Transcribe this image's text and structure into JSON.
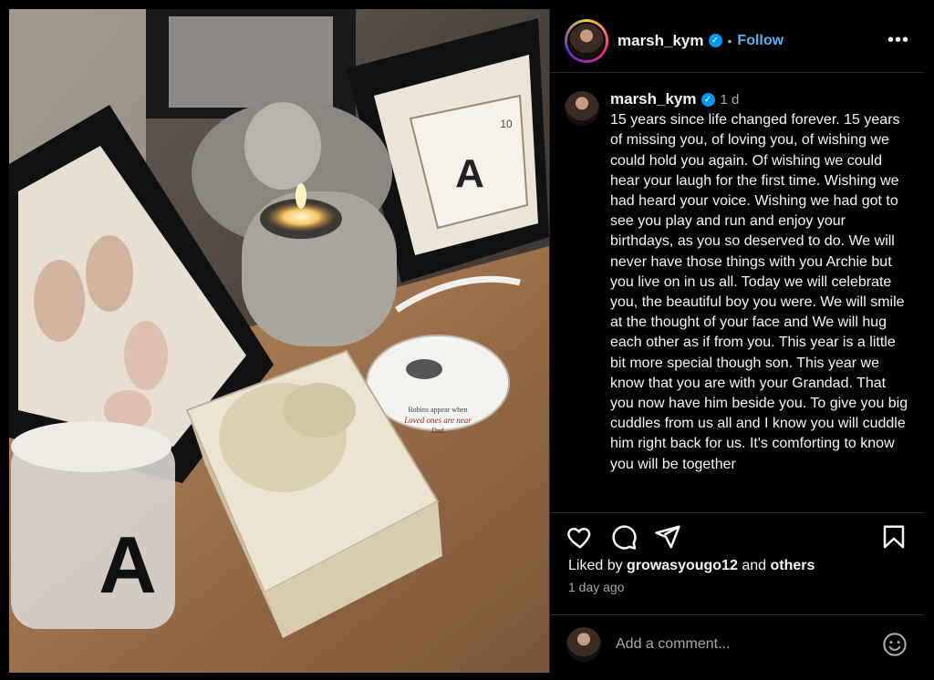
{
  "post": {
    "username": "marsh_kym",
    "follow_label": "Follow",
    "more_glyph": "•••",
    "caption_time": "1 d",
    "caption_text": "15 years since life changed forever. 15 years of missing you, of loving you, of wishing we could hold you again. Of wishing we could hear your laugh for the first time. Wishing we had heard your voice. Wishing we had got to see you play and run and enjoy your birthdays, as you so deserved to do. We will never have those things with you Archie but you live on in us all. Today we will celebrate you, the beautiful boy you were. We will smile at the thought of your face and We will hug each other as if from you. This year is a little bit more special though son. This year we know that you are with your Grandad. That you now have him beside you. To give you big cuddles from us all and I know you will cuddle him right back for us. It's comforting to know you will be together",
    "likes_prefix": "Liked by",
    "likes_user": "growasyougo12",
    "likes_and": "and",
    "likes_others": "others",
    "posted_ago": "1 day ago"
  },
  "comment": {
    "placeholder": "Add a comment..."
  },
  "photo": {
    "card_letter": "A",
    "card_number": "10",
    "candle_letter": "A",
    "ornament_text_1": "Robins appear when",
    "ornament_text_2": "Loved ones are near",
    "ornament_text_3": "Dad"
  },
  "icons": {
    "like": "heart-icon",
    "comment": "comment-icon",
    "share": "share-icon",
    "save": "bookmark-icon",
    "emoji": "emoji-icon",
    "verified": "verified-badge-icon"
  },
  "colors": {
    "background": "#000000",
    "link": "#4cb5f9",
    "verified": "#0095f6",
    "muted": "#a8a8a8"
  }
}
